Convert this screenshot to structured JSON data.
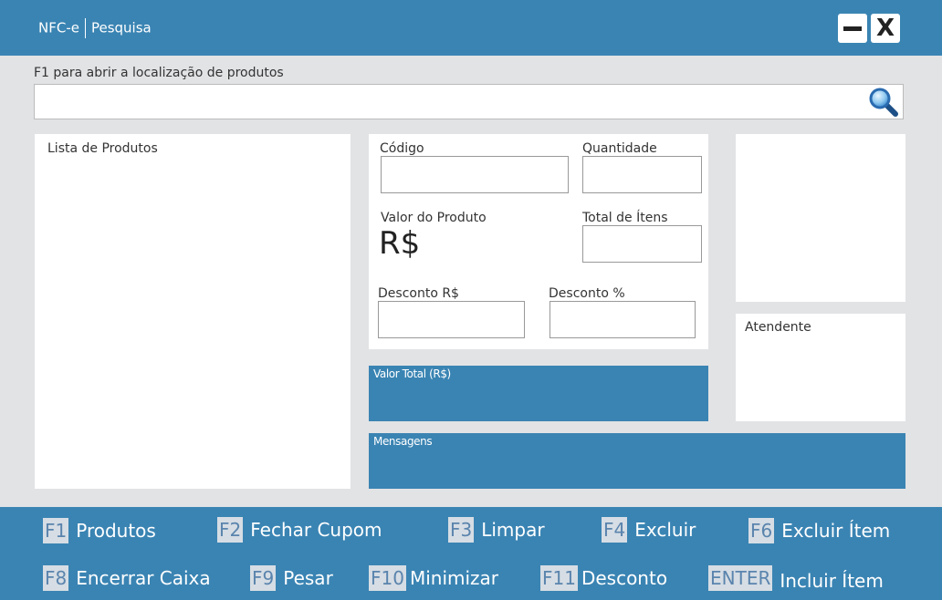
{
  "window": {
    "app_name": "NFC-e",
    "section": "Pesquisa"
  },
  "search": {
    "label": "F1 para abrir a localização de produtos",
    "value": "",
    "placeholder": ""
  },
  "product_list": {
    "title": "Lista de Produtos"
  },
  "form": {
    "codigo_label": "Código",
    "quantidade_label": "Quantidade",
    "valor_produto_label": "Valor do Produto",
    "valor_produto_value": "R$",
    "total_itens_label": "Total de Ítens",
    "desconto_rs_label": "Desconto R$",
    "desconto_pct_label": "Desconto %"
  },
  "attendant": {
    "label": "Atendente"
  },
  "valor_total": {
    "label": "Valor Total (R$)"
  },
  "messages": {
    "label": "Mensagens"
  },
  "shortcuts": [
    {
      "key": "F1",
      "label": "Produtos"
    },
    {
      "key": "F2",
      "label": "Fechar Cupom"
    },
    {
      "key": "F3",
      "label": "Limpar"
    },
    {
      "key": "F4",
      "label": "Excluir"
    },
    {
      "key": "F6",
      "label": "Excluir Ítem"
    },
    {
      "key": "F8",
      "label": "Encerrar Caixa"
    },
    {
      "key": "F9",
      "label": "Pesar"
    },
    {
      "key": "F10",
      "label": "Minimizar"
    },
    {
      "key": "F11",
      "label": "Desconto"
    },
    {
      "key": "ENTER",
      "label": "Incluir Ítem"
    }
  ],
  "colors": {
    "accent": "#3a84b3",
    "background": "#e2e3e5",
    "key_bg": "#d6dde4"
  },
  "icons": {
    "search": "magnifier-icon",
    "minimize": "minimize-icon",
    "close": "close-icon"
  }
}
